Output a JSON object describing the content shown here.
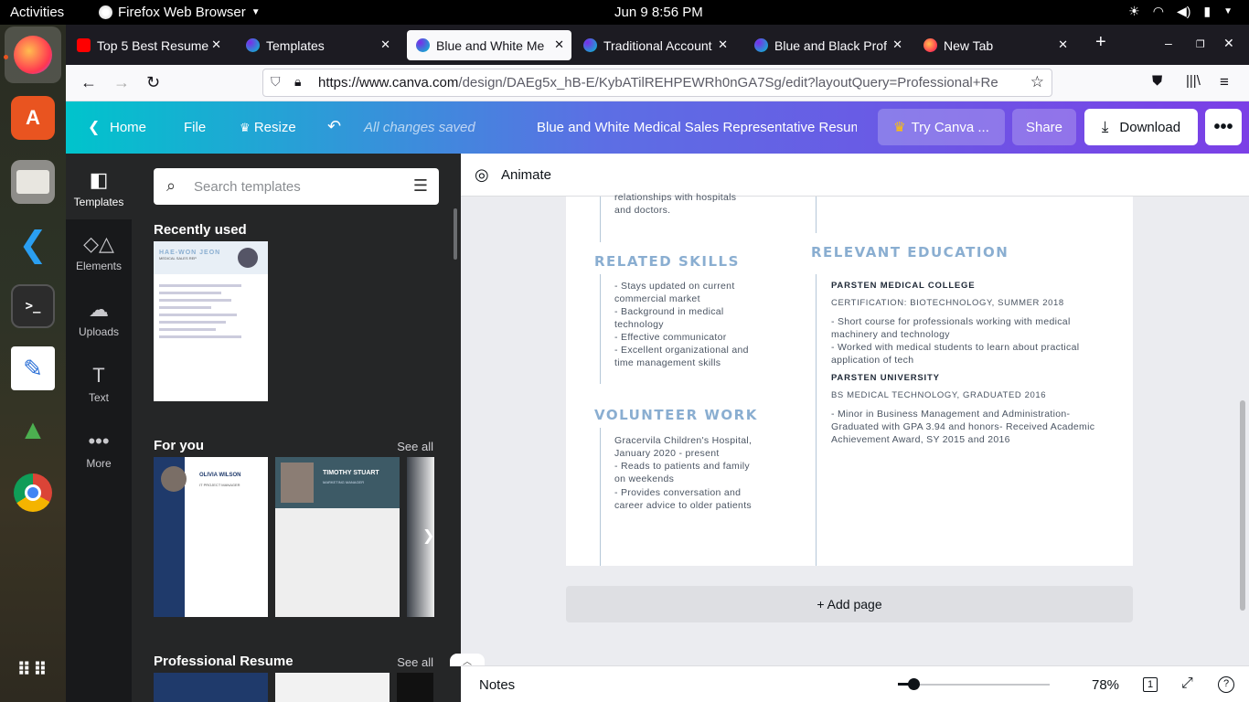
{
  "topbar": {
    "activities": "Activities",
    "app": "Firefox Web Browser",
    "clock": "Jun 9  8:56 PM"
  },
  "dock": {
    "items": [
      "firefox-icon",
      "software-center-icon",
      "files-icon",
      "vscode-icon",
      "terminal-icon",
      "text-editor-icon",
      "rocket-icon",
      "chrome-icon",
      "app-grid-icon"
    ]
  },
  "browser": {
    "tabs": [
      {
        "title": "Top 5 Best Resume"
      },
      {
        "title": "Templates"
      },
      {
        "title": "Blue and White Me"
      },
      {
        "title": "Traditional Account"
      },
      {
        "title": "Blue and Black Prof"
      },
      {
        "title": "New Tab"
      }
    ],
    "url_host": "https://www.canva.com",
    "url_path": "/design/DAEg5x_hB-E/KybATilREHPEWRh0nGA7Sg/edit?layoutQuery=Professional+Re"
  },
  "canva": {
    "header": {
      "home": "Home",
      "file": "File",
      "resize": "Resize",
      "saved": "All changes saved",
      "doc_title": "Blue and White Medical Sales Representative Resum",
      "try": "Try Canva ...",
      "share": "Share",
      "download": "Download",
      "more": "•••"
    },
    "sidenav": [
      {
        "label": "Templates",
        "icon": "templates-icon"
      },
      {
        "label": "Elements",
        "icon": "elements-icon"
      },
      {
        "label": "Uploads",
        "icon": "uploads-icon"
      },
      {
        "label": "Text",
        "icon": "text-icon"
      },
      {
        "label": "More",
        "icon": "more-icon"
      }
    ],
    "panel": {
      "search_placeholder": "Search templates",
      "recently_used": "Recently used",
      "for_you": "For you",
      "see_all": "See all",
      "professional_resume": "Professional Resume",
      "recent_thumb": {
        "name": "HAE-WON JEON",
        "role": "MEDICAL SALES REP"
      },
      "for_you_thumbs": [
        {
          "name": "OLIVIA WILSON",
          "role": "IT PROJECT MANAGER"
        },
        {
          "name": "TIMOTHY STUART",
          "role": "MARKETING MANAGER"
        }
      ]
    },
    "workspace": {
      "animate": "Animate",
      "resume": {
        "top_fragment": "relationships with hospitals and doctors.",
        "related_skills_title": "RELATED SKILLS",
        "skills": [
          "- Stays updated on current commercial market",
          "- Background in medical technology",
          "- Effective communicator",
          "- Excellent organizational and time management skills"
        ],
        "volunteer_title": "VOLUNTEER WORK",
        "volunteer": [
          "Gracervila Children's Hospital, January 2020 - present",
          "- Reads to patients and family on weekends",
          "- Provides conversation and career advice to older patients"
        ],
        "education_title": "RELEVANT EDUCATION",
        "edu1_name": "PARSTEN MEDICAL COLLEGE",
        "edu1_cert": "CERTIFICATION: BIOTECHNOLOGY, SUMMER 2018",
        "edu1_points": [
          "- Short course for professionals working with medical machinery and technology",
          "- Worked with medical students to learn about practical application of tech"
        ],
        "edu2_name": "PARSTEN UNIVERSITY",
        "edu2_degree": "BS MEDICAL TECHNOLOGY, GRADUATED 2016",
        "edu2_points": "- Minor in Business Management and Administration- Graduated with GPA 3.94 and honors- Received Academic Achievement Award, SY 2015 and 2016"
      },
      "add_page": "+ Add page"
    },
    "footer": {
      "notes": "Notes",
      "zoom": "78%",
      "zoom_level": 0.1,
      "page_count": "1"
    }
  }
}
